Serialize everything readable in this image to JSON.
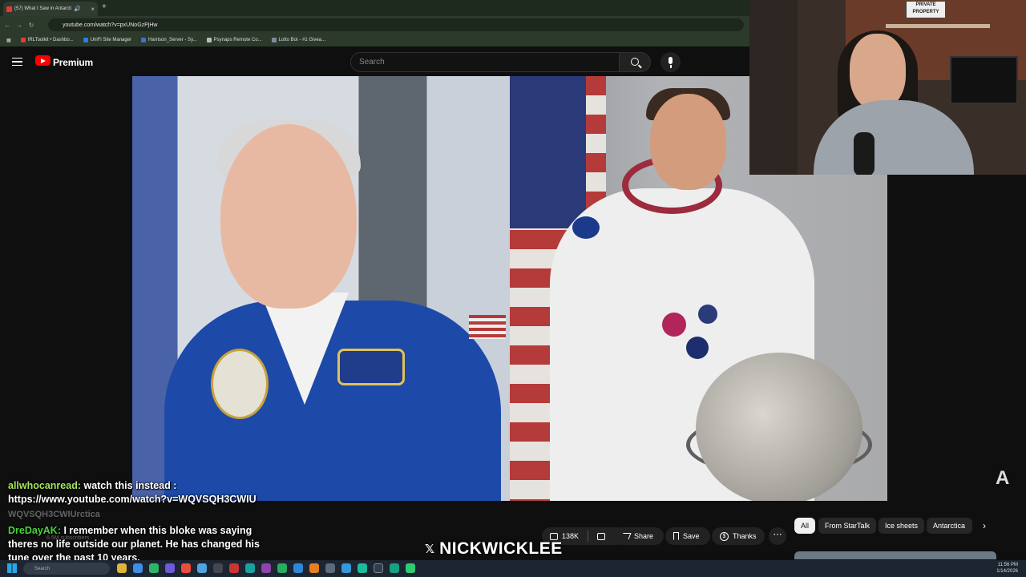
{
  "browser": {
    "tab_title": "(57) What I Saw in Antarcti",
    "new_tab": "+",
    "url": "youtube.com/watch?v=pxUNoGzPjHw",
    "bookmarks": [
      "IRLToolkit • Dashbo...",
      "UniFi Site Manager",
      "Harrison_Server - Sy...",
      "Psynaps Remote Co...",
      "Lotto Bot - #1 Givea..."
    ]
  },
  "youtube": {
    "logo_text": "Premium",
    "search_placeholder": "Search",
    "actions": {
      "likes": "138K",
      "share": "Share",
      "save": "Save",
      "thanks": "Thanks",
      "more": "⋯"
    },
    "chips": [
      "All",
      "From StarTalk",
      "Ice sheets",
      "Antarctica"
    ],
    "chip_next": "›",
    "channel_ghost": "WQVSQH3CWIUrctica",
    "subs_ghost": "6.5M subscribers"
  },
  "webcam": {
    "sign_text": "PRIVATE PROPERTY"
  },
  "chat": [
    {
      "user": "allwhocanread:",
      "message": " watch this instead : https://www.youtube.com/watch?v=WQVSQH3CWIU"
    },
    {
      "user": "DreDayAK:",
      "message": " I remember when this bloke was saying theres no life outside our planet. He has changed his tune over the past 10 years."
    }
  ],
  "banner": {
    "x_logo": "𝕏",
    "name": "NICKWICKLEE"
  },
  "taskbar": {
    "search_placeholder": "Search",
    "time": "11:56 PM",
    "date": "1/14/2026"
  },
  "colors": {
    "chat_user1": "#a4e35a",
    "chat_user2": "#4cd33d",
    "yt_red": "#ff0000"
  }
}
